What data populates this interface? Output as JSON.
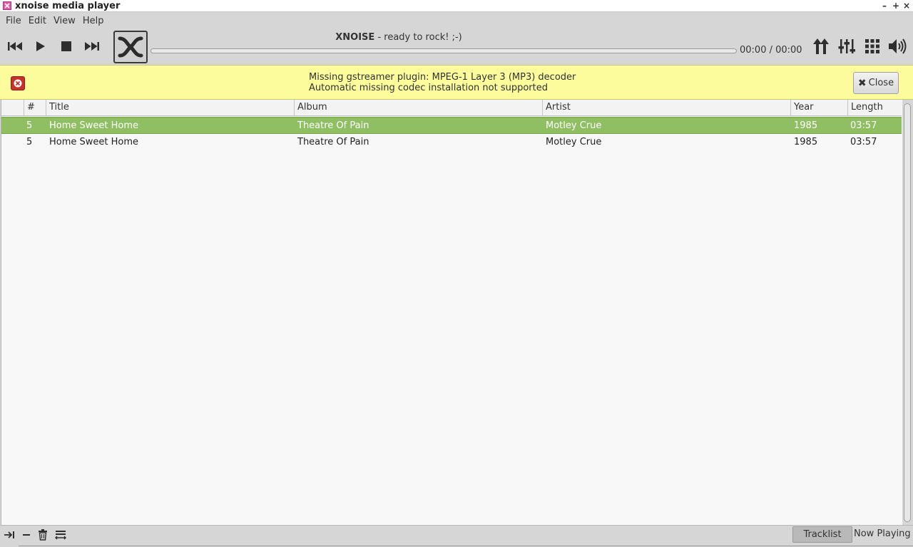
{
  "window": {
    "title": "xnoise media player"
  },
  "menu": [
    "File",
    "Edit",
    "View",
    "Help"
  ],
  "player": {
    "app_name": "XNOISE",
    "status_suffix": " - ready to rock! ;-)",
    "time": "00:00 / 00:00",
    "progress": 0
  },
  "infobar": {
    "line1": "Missing gstreamer plugin: MPEG-1 Layer 3 (MP3) decoder",
    "line2": "Automatic missing codec installation not supported",
    "close_label": "Close"
  },
  "tracklist": {
    "columns": [
      "#",
      "Title",
      "Album",
      "Artist",
      "Year",
      "Length"
    ],
    "rows": [
      {
        "num": "5",
        "title": "Home Sweet Home",
        "album": "Theatre Of Pain",
        "artist": "Motley Crue",
        "year": "1985",
        "length": "03:57",
        "selected": true
      },
      {
        "num": "5",
        "title": "Home Sweet Home",
        "album": "Theatre Of Pain",
        "artist": "Motley Crue",
        "year": "1985",
        "length": "03:57",
        "selected": false
      }
    ]
  },
  "bottom": {
    "tabs": [
      "Tracklist",
      "Now Playing"
    ]
  },
  "colors": {
    "selection": "#8fbf62",
    "infobar": "#fcfc9c",
    "error": "#c9302c"
  }
}
